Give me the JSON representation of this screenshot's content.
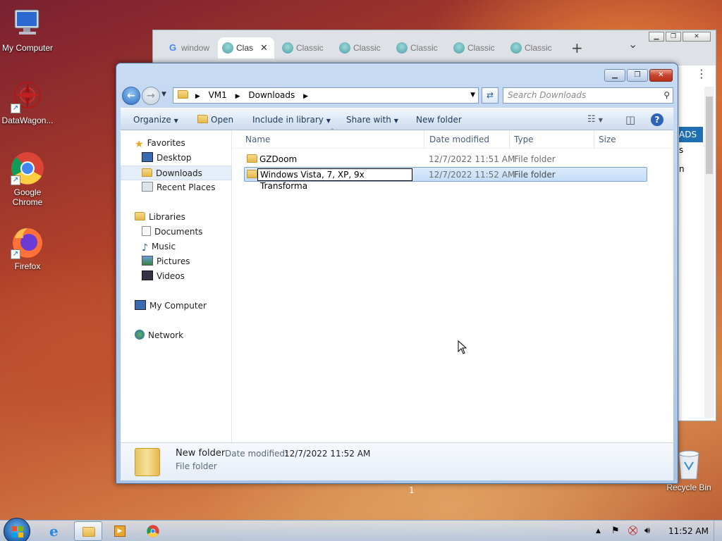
{
  "desktop": {
    "icons": [
      {
        "label": "My Computer"
      },
      {
        "label": "DataWagon..."
      },
      {
        "label": "Google Chrome"
      },
      {
        "label": "Firefox"
      },
      {
        "label": "Recycle Bin"
      }
    ],
    "page_marker": "1"
  },
  "chrome": {
    "tabs": [
      {
        "title": "window"
      },
      {
        "title": "Clas"
      },
      {
        "title": "Classic"
      },
      {
        "title": "Classic"
      },
      {
        "title": "Classic"
      },
      {
        "title": "Classic"
      },
      {
        "title": "Classic"
      }
    ],
    "new_tab": "+",
    "tab_list": "⌄",
    "partial_text": {
      "ads": "ADS",
      "s": "s",
      "n": "n"
    }
  },
  "explorer": {
    "breadcrumb": [
      "VM1",
      "Downloads"
    ],
    "search_placeholder": "Search Downloads",
    "toolbar": {
      "organize": "Organize",
      "open": "Open",
      "include": "Include in library",
      "share": "Share with",
      "new_folder": "New folder"
    },
    "nav": {
      "favorites": "Favorites",
      "desktop": "Desktop",
      "downloads": "Downloads",
      "recent": "Recent Places",
      "libraries": "Libraries",
      "documents": "Documents",
      "music": "Music",
      "pictures": "Pictures",
      "videos": "Videos",
      "computer": "My Computer",
      "network": "Network"
    },
    "columns": {
      "name": "Name",
      "date": "Date modified",
      "type": "Type",
      "size": "Size"
    },
    "files": [
      {
        "name": "GZDoom",
        "date": "12/7/2022 11:51 AM",
        "type": "File folder"
      },
      {
        "name": "Windows Vista, 7, XP, 9x Transforma",
        "date": "12/7/2022 11:52 AM",
        "type": "File folder"
      }
    ],
    "details": {
      "name": "New folder",
      "date_label": "Date modified:",
      "date_value": "12/7/2022 11:52 AM",
      "type": "File folder"
    }
  },
  "taskbar": {
    "clock": "11:52 AM"
  }
}
